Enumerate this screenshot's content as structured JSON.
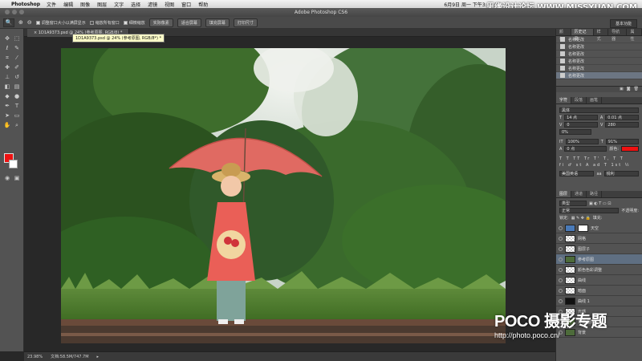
{
  "menubar": {
    "app": "Photoshop",
    "items": [
      "文件",
      "编辑",
      "图像",
      "图层",
      "文字",
      "选择",
      "滤镜",
      "视图",
      "窗口",
      "帮助"
    ],
    "clock": "6月9日 周一 下午3:43:14"
  },
  "site_watermark_top": "思缘设计论坛 WWW.MISSYUAN.COM",
  "window_title": "Adobe Photoshop CS6",
  "options_bar": {
    "check1": "调整窗口大小以满屏显示",
    "check2": "缩放所有窗口",
    "check3": "细微缩放",
    "btn_actual": "实际像素",
    "btn_fit": "适合屏幕",
    "btn_fill": "填充屏幕",
    "btn_print": "打印尺寸",
    "workspace": "基本功能"
  },
  "document_tab": "1D1A9373.psd @ 24% (参考原图, RGB/8) *",
  "tooltip": "1D1A9373.psd @ 24% (参考原图, RGB/8*) *",
  "status_bar": {
    "zoom": "23.98%",
    "doc_size": "文档:58.5M/747.7M"
  },
  "colors": {
    "foreground": "#ee1111",
    "background": "#ffffff",
    "selection": "#5f6f82"
  },
  "history_panel": {
    "tabs": [
      "颜色",
      "历史记录",
      "样式",
      "导航器",
      "属性"
    ],
    "active_tab": "历史记录",
    "rows": [
      "名称更改",
      "名称更改",
      "名称更改",
      "名称更改",
      "名称更改",
      "名称更改"
    ]
  },
  "character_panel": {
    "tabs": [
      "字符",
      "段落",
      "画笔"
    ],
    "font_size": "14 点",
    "leading": "0.01 点",
    "tracking_v": "0",
    "tracking": "280",
    "scale_pct": "0%",
    "vscale": "100%",
    "hscale": "91%",
    "baseline": "0 点",
    "color_label": "颜色:",
    "lang": "美国英语",
    "aa": "锐利"
  },
  "layers_panel": {
    "tabs": [
      "图层",
      "通道",
      "路径"
    ],
    "kind": "类型",
    "blend": "正常",
    "opacity_label": "不透明度:",
    "lock_label": "锁定:",
    "fill_label": "填充:",
    "layers": [
      {
        "name": "天空",
        "selected": false
      },
      {
        "name": "网格",
        "selected": false
      },
      {
        "name": "图层子",
        "selected": false
      },
      {
        "name": "参考原图",
        "selected": true
      },
      {
        "name": "颜色色彩调整",
        "selected": false
      },
      {
        "name": "曲线",
        "selected": false
      },
      {
        "name": "暗面",
        "selected": false
      },
      {
        "name": "曲线 1",
        "selected": false
      },
      {
        "name": "光感",
        "selected": false
      },
      {
        "name": "背景 副本",
        "selected": false
      },
      {
        "name": "背景",
        "selected": false
      }
    ]
  },
  "watermark": {
    "brand": "POCO 摄影专题",
    "url": "http://photo.poco.cn/"
  }
}
